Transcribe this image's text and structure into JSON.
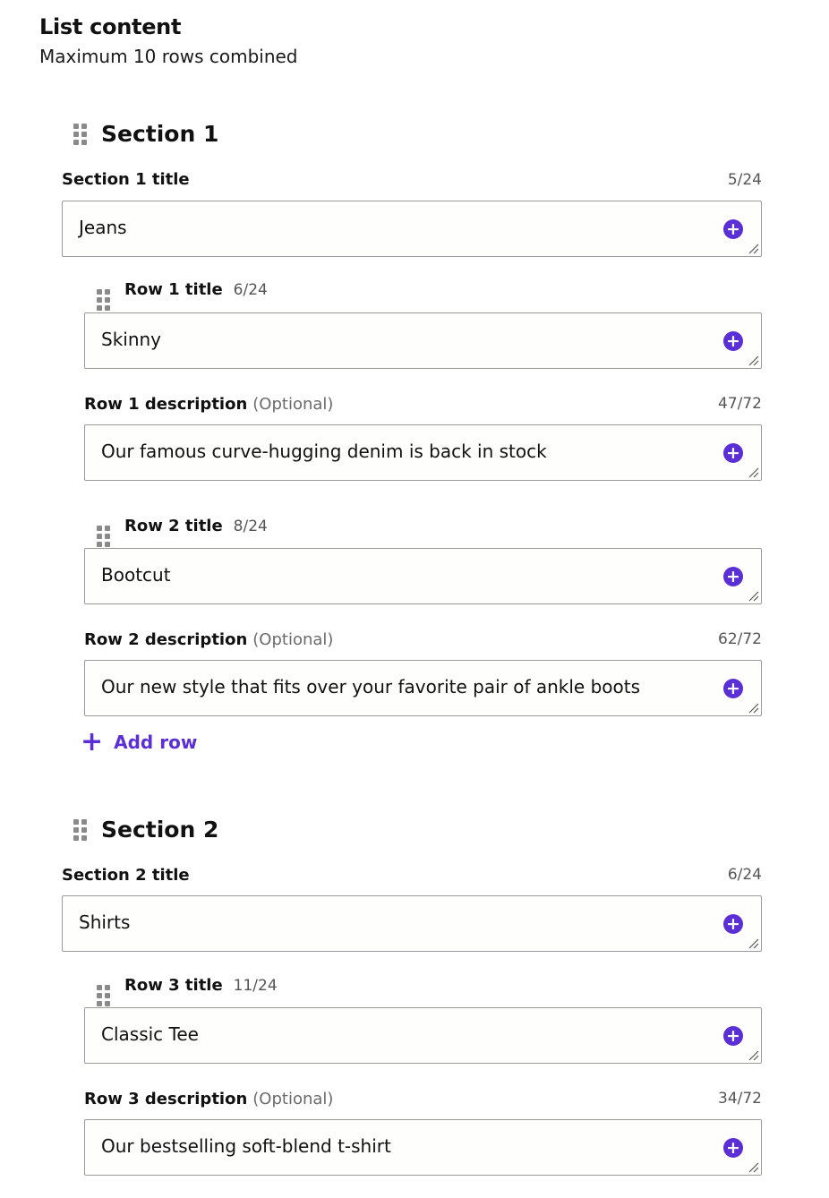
{
  "header": {
    "title": "List content",
    "subtitle": "Maximum 10 rows combined"
  },
  "add_row_label": "Add row",
  "optional_label": "(Optional)",
  "accent_color": "#5b2fd6",
  "icons": {
    "drag": "drag-handle-icon",
    "add": "add-circle-icon",
    "resize": "resize-grip-icon",
    "plus": "plus-icon"
  },
  "sections": [
    {
      "heading": "Section 1",
      "title_label": "Section 1 title",
      "title_count": "5/24",
      "title_value": "Jeans",
      "rows": [
        {
          "title_label": "Row 1 title",
          "title_count": "6/24",
          "title_value": "Skinny",
          "desc_label": "Row 1 description",
          "desc_count": "47/72",
          "desc_value": "Our famous curve-hugging denim is back in stock"
        },
        {
          "title_label": "Row 2 title",
          "title_count": "8/24",
          "title_value": "Bootcut",
          "desc_label": "Row 2 description",
          "desc_count": "62/72",
          "desc_value": "Our new style that fits over your favorite pair of ankle boots"
        }
      ]
    },
    {
      "heading": "Section 2",
      "title_label": "Section 2 title",
      "title_count": "6/24",
      "title_value": "Shirts",
      "rows": [
        {
          "title_label": "Row 3 title",
          "title_count": "11/24",
          "title_value": "Classic Tee",
          "desc_label": "Row 3 description",
          "desc_count": "34/72",
          "desc_value": "Our bestselling soft-blend t-shirt"
        }
      ]
    }
  ]
}
